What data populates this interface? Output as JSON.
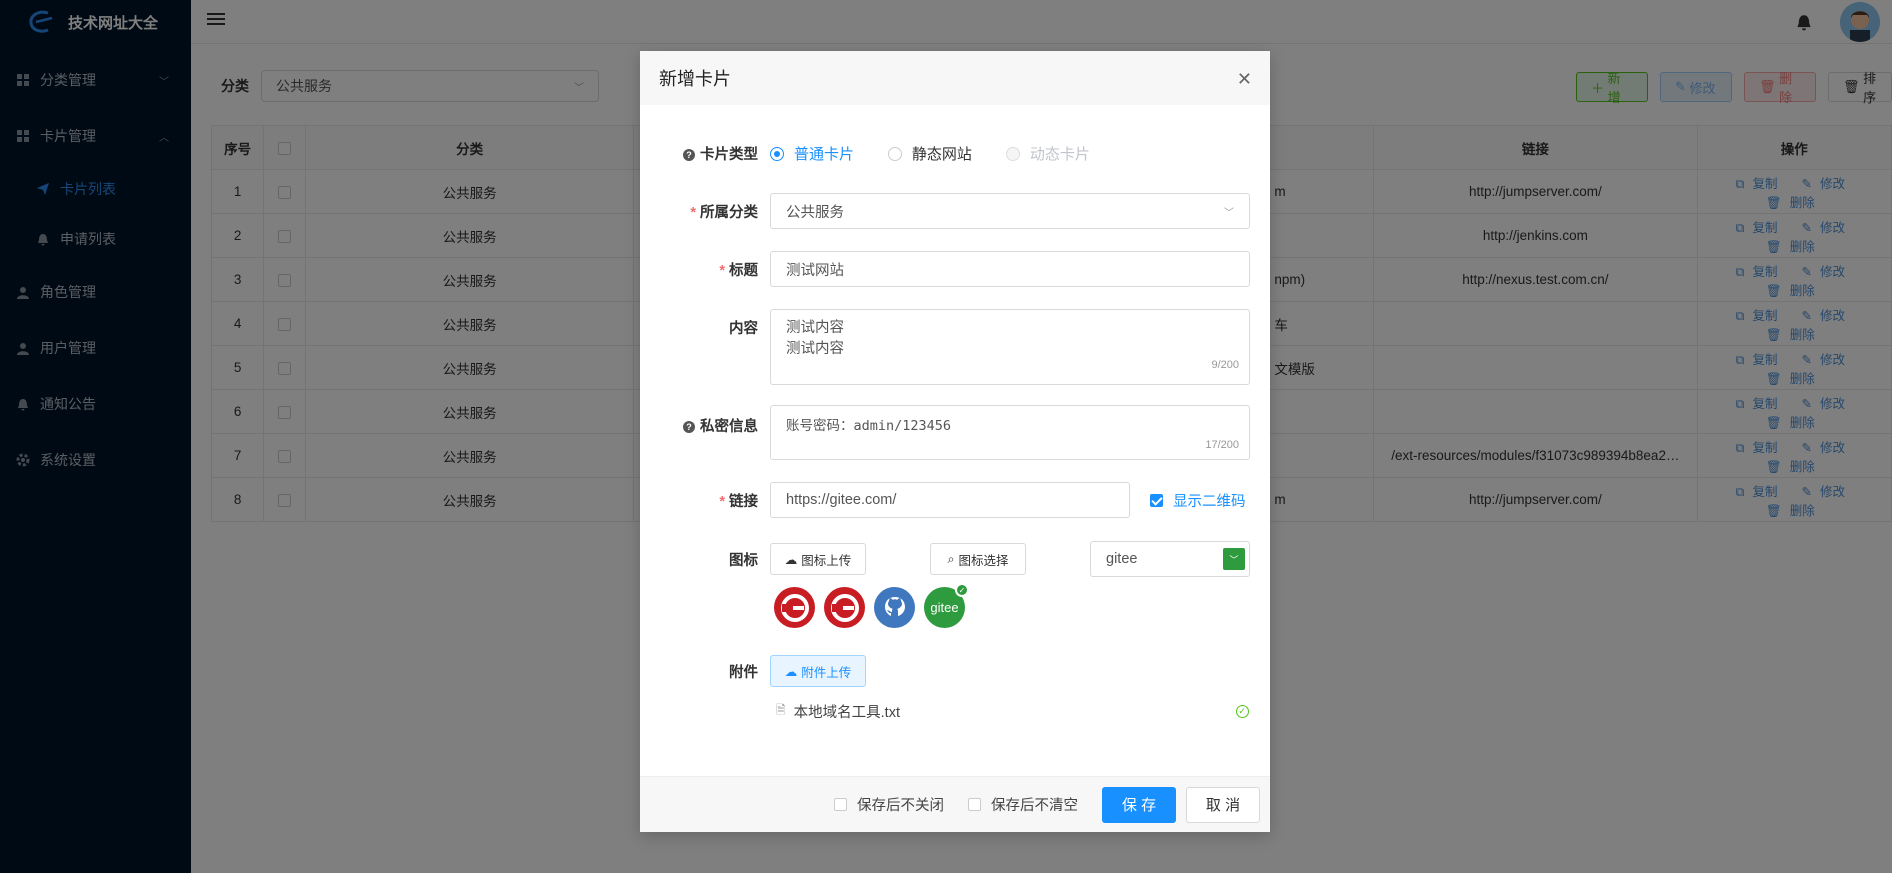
{
  "app": {
    "title": "技术网址大全"
  },
  "sidebar": {
    "items": [
      {
        "label": "分类管理"
      },
      {
        "label": "卡片管理"
      },
      {
        "label": "卡片列表"
      },
      {
        "label": "申请列表"
      },
      {
        "label": "角色管理"
      },
      {
        "label": "用户管理"
      },
      {
        "label": "通知公告"
      },
      {
        "label": "系统设置"
      }
    ]
  },
  "filter": {
    "label": "分类",
    "value": "公共服务"
  },
  "toolbar": {
    "add": "新增",
    "edit": "修改",
    "delete": "删除",
    "sort": "排序"
  },
  "table": {
    "headers": {
      "index": "序号",
      "category": "分类",
      "link": "链接",
      "ops": "操作"
    },
    "rows": [
      {
        "index": "1",
        "category": "公共服务",
        "desc": "m",
        "link": "http://jumpserver.com/"
      },
      {
        "index": "2",
        "category": "公共服务",
        "desc": "",
        "link": "http://jenkins.com"
      },
      {
        "index": "3",
        "category": "公共服务",
        "desc": "npm)",
        "link": "http://nexus.test.com.cn/"
      },
      {
        "index": "4",
        "category": "公共服务",
        "desc": "车",
        "link": ""
      },
      {
        "index": "5",
        "category": "公共服务",
        "desc": "文模版",
        "link": ""
      },
      {
        "index": "6",
        "category": "公共服务",
        "desc": "",
        "link": ""
      },
      {
        "index": "7",
        "category": "公共服务",
        "desc": "",
        "link": "/ext-resources/modules/f31073c989394b8ea2…"
      },
      {
        "index": "8",
        "category": "公共服务",
        "desc": "m",
        "link": "http://jumpserver.com/"
      }
    ],
    "op_copy": "复制",
    "op_edit": "修改",
    "op_delete": "删除"
  },
  "modal": {
    "title": "新增卡片",
    "card_type": {
      "label": "卡片类型",
      "options": [
        "普通卡片",
        "静态网站",
        "动态卡片"
      ],
      "selected": "普通卡片"
    },
    "category": {
      "label": "所属分类",
      "value": "公共服务"
    },
    "title_field": {
      "label": "标题",
      "value": "测试网站"
    },
    "content": {
      "label": "内容",
      "line1": "测试内容",
      "line2": "测试内容",
      "count": "9/200"
    },
    "private": {
      "label": "私密信息",
      "value": "账号密码：admin/123456",
      "count": "17/200"
    },
    "link": {
      "label": "链接",
      "value": "https://gitee.com/",
      "qr_label": "显示二维码",
      "qr_checked": true
    },
    "icon": {
      "label": "图标",
      "upload": "图标上传",
      "choose": "图标选择",
      "search_value": "gitee",
      "options": [
        "gitee-red-icon",
        "gitee-red-icon",
        "github-icon",
        "gitee-green-icon"
      ],
      "gitee_text": "gitee",
      "selected_index": 3
    },
    "attachment": {
      "label": "附件",
      "upload": "附件上传",
      "file": "本地域名工具.txt"
    },
    "footer": {
      "keep_open": "保存后不关闭",
      "keep_values": "保存后不清空",
      "save": "保 存",
      "cancel": "取 消"
    }
  },
  "colors": {
    "primary": "#1890ff",
    "sidebar_bg": "#001529",
    "gitee_red": "#c71d23",
    "gitee_green": "#2e9b3e",
    "github_blue": "#4078c0"
  }
}
